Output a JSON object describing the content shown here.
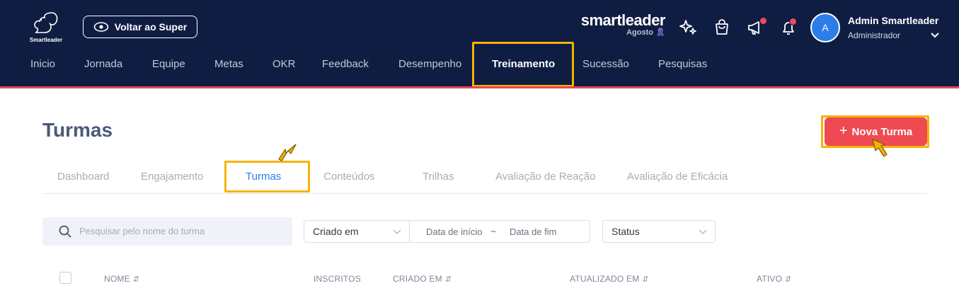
{
  "header": {
    "logo_text": "Smartleader",
    "back_button": "Voltar ao Super",
    "brand": {
      "name": "smartleader",
      "month": "Agosto",
      "ribbon": "🎗"
    },
    "icons": [
      "sparkles-icon",
      "shopping-bag-icon",
      "megaphone-icon",
      "bell-icon"
    ],
    "user": {
      "initial": "A",
      "name": "Admin Smartleader",
      "role": "Administrador"
    }
  },
  "nav": {
    "items": [
      "Inicio",
      "Jornada",
      "Equipe",
      "Metas",
      "OKR",
      "Feedback",
      "Desempenho",
      "Treinamento",
      "Sucessão",
      "Pesquisas"
    ],
    "active": "Treinamento"
  },
  "page": {
    "title": "Turmas",
    "new_button": "Nova Turma",
    "new_button_icon": "+"
  },
  "tabs": {
    "items": [
      "Dashboard",
      "Engajamento",
      "Turmas",
      "Conteúdos",
      "Trilhas",
      "Avaliação de Reação",
      "Avaliação de Eficácia"
    ],
    "active": "Turmas"
  },
  "filters": {
    "search_placeholder": "Pesquisar pelo nome do turma",
    "date_field": "Criado em",
    "date_start_placeholder": "Data de início",
    "date_separator": "~",
    "date_end_placeholder": "Data de fim",
    "status_placeholder": "Status"
  },
  "table": {
    "columns": [
      "NOME",
      "INSCRITOS",
      "CRIADO EM",
      "ATUALIZADO EM",
      "ATIVO"
    ]
  },
  "colors": {
    "header_bg": "#0f1d42",
    "accent_red": "#ef4a52",
    "active_tab": "#2b7de9",
    "highlight": "#f5b301"
  }
}
